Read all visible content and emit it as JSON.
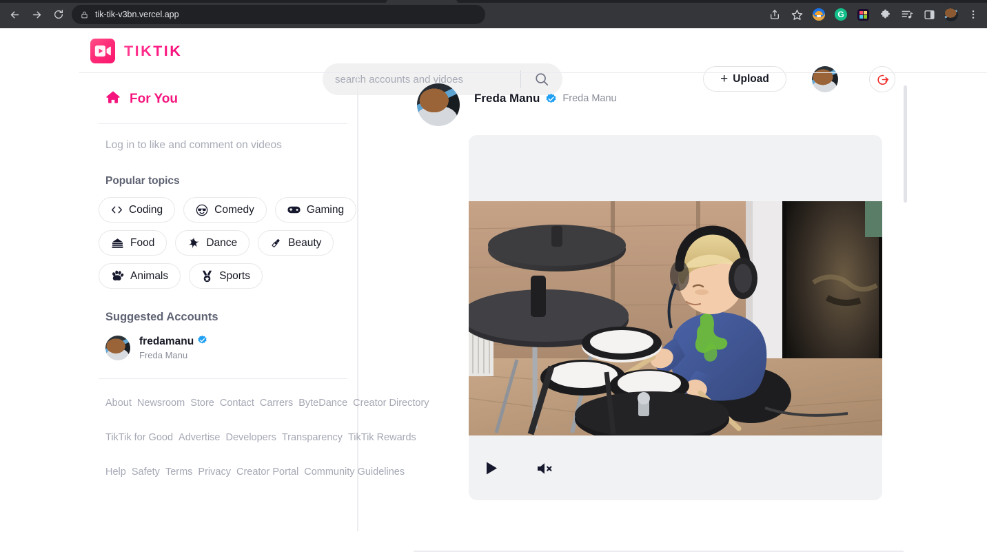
{
  "browser": {
    "url": "tik-tik-v3bn.vercel.app",
    "back_icon": "back-arrow-icon",
    "forward_icon": "forward-arrow-icon",
    "reload_icon": "reload-icon",
    "lock_icon": "lock-icon",
    "share_icon": "share-icon",
    "bookmark_icon": "star-icon",
    "extensions_icon": "puzzle-piece-icon",
    "reading_list_icon": "reading-list-icon",
    "side_panel_icon": "side-panel-icon",
    "menu_icon": "three-dot-menu-icon",
    "grammarly_letter": "G"
  },
  "header": {
    "brand_name": "TIKTIK",
    "brand_icon": "video-camera-play-icon",
    "upload_label": "Upload",
    "upload_plus": "+",
    "logout_icon": "logout-icon"
  },
  "search": {
    "placeholder": "search accounts and vidoes",
    "value": "",
    "icon": "search-icon"
  },
  "sidebar": {
    "for_you": {
      "label": "For You",
      "icon": "home-icon"
    },
    "login_note": "Log in to like and comment on videos",
    "popular_topics_title": "Popular topics",
    "topics": [
      {
        "label": "Coding",
        "icon": "code-brackets-icon",
        "glyph": "‹›"
      },
      {
        "label": "Comedy",
        "icon": "sunglasses-smiley-icon",
        "glyph": "😎"
      },
      {
        "label": "Gaming",
        "icon": "gamepad-icon",
        "glyph": "🎮"
      },
      {
        "label": "Food",
        "icon": "cake-slice-icon",
        "glyph": "🍰"
      },
      {
        "label": "Dance",
        "icon": "dance-sparkle-icon",
        "glyph": "❇"
      },
      {
        "label": "Beauty",
        "icon": "lipstick-icon",
        "glyph": "💄"
      },
      {
        "label": "Animals",
        "icon": "paw-print-icon",
        "glyph": "🐾"
      },
      {
        "label": "Sports",
        "icon": "medal-icon",
        "glyph": "🏅"
      }
    ],
    "suggested_title": "Suggested Accounts",
    "suggested_account": {
      "handle": "fredamanu",
      "full_name": "Freda Manu",
      "verified": true,
      "verified_icon": "verified-badge-icon"
    },
    "footer_groups": [
      [
        "About",
        "Newsroom",
        "Store",
        "Contact",
        "Carrers",
        "ByteDance",
        "Creator Directory"
      ],
      [
        "TikTik for Good",
        "Advertise",
        "Developers",
        "Transparency",
        "TikTik Rewards"
      ],
      [
        "Help",
        "Safety",
        "Terms",
        "Privacy",
        "Creator Portal",
        "Community Guidelines"
      ]
    ]
  },
  "feed": {
    "post": {
      "display_name": "Freda Manu",
      "sub_name": "Freda Manu",
      "verified": true,
      "verified_icon": "verified-badge-icon",
      "avatar_icon": "user-avatar",
      "video_description": "Young blonde child wearing headphones playing an electronic drum kit in a room with wood-panel wall and a dark framed painting",
      "play_icon": "play-icon",
      "mute_icon": "muted-speaker-icon",
      "is_playing": false,
      "is_muted": true
    }
  },
  "colors": {
    "brand_pink": "#f5147d",
    "verified_blue": "#20a0f3",
    "logout_red": "#ef2a2a",
    "card_gray": "#f1f2f4",
    "chrome_dark": "#35363a"
  }
}
